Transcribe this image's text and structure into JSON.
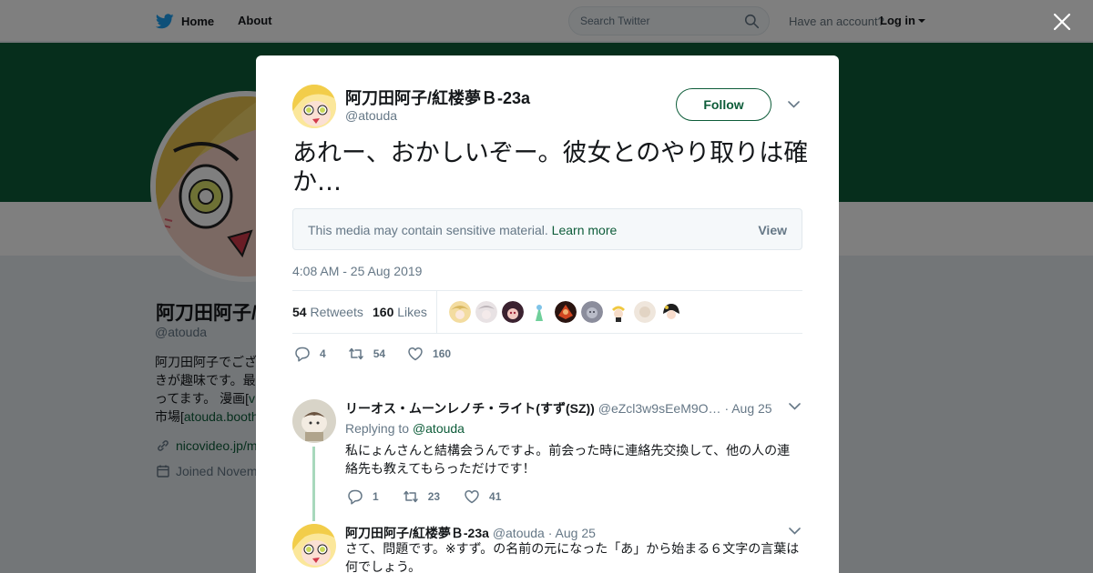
{
  "nav": {
    "home_label": "Home",
    "about_label": "About",
    "search_placeholder": "Search Twitter",
    "account_prompt": "Have an account?",
    "login_label": "Log in"
  },
  "profile": {
    "name": "阿刀田阿子/",
    "handle": "@atouda",
    "bio_lines": [
      "阿刀田阿子でござ",
      "きが趣味です。最",
      "ってます。 漫画[",
      "市場["
    ],
    "bio_links": [
      "v",
      "atouda.booth"
    ],
    "link": "nicovideo.jp/m",
    "joined": "Joined Novem"
  },
  "tweet": {
    "author_name": "阿刀田阿子/紅楼夢Ｂ-23a",
    "author_handle": "@atouda",
    "follow_label": "Follow",
    "text": "あれー、おかしいぞー。彼女とのやり取りは確か…",
    "sensitive_text": "This media may contain sensitive material.",
    "learn_more": "Learn more",
    "view_label": "View",
    "timestamp": "4:08 AM - 25 Aug 2019",
    "retweets_count": "54",
    "retweets_label": "Retweets",
    "likes_count": "160",
    "likes_label": "Likes",
    "actions": {
      "replies": "4",
      "retweets": "54",
      "likes": "160"
    }
  },
  "replies": [
    {
      "name": "リーオス・ムーンレノチ・ライト(すず(SZ))",
      "handle": "@eZcl3w9sEeM9O…",
      "date": "· Aug 25",
      "replying_prefix": "Replying to",
      "replying_to": "@atouda",
      "text": "私にょんさんと結構会うんですよ。前会った時に連絡先交換して、他の人の連絡先も教えてもらっただけです！",
      "replies": "1",
      "retweets": "23",
      "likes": "41"
    },
    {
      "name": "阿刀田阿子/紅楼夢Ｂ-23a",
      "handle": "@atouda",
      "date": "· Aug 25",
      "text": "さて、問題です。※すず。の名前の元になった「あ」から始まる６文字の言葉は何でしょう。"
    }
  ],
  "colors": {
    "brand": "#0d5c39",
    "banner": "#0d5c39",
    "text_secondary": "#657786"
  }
}
